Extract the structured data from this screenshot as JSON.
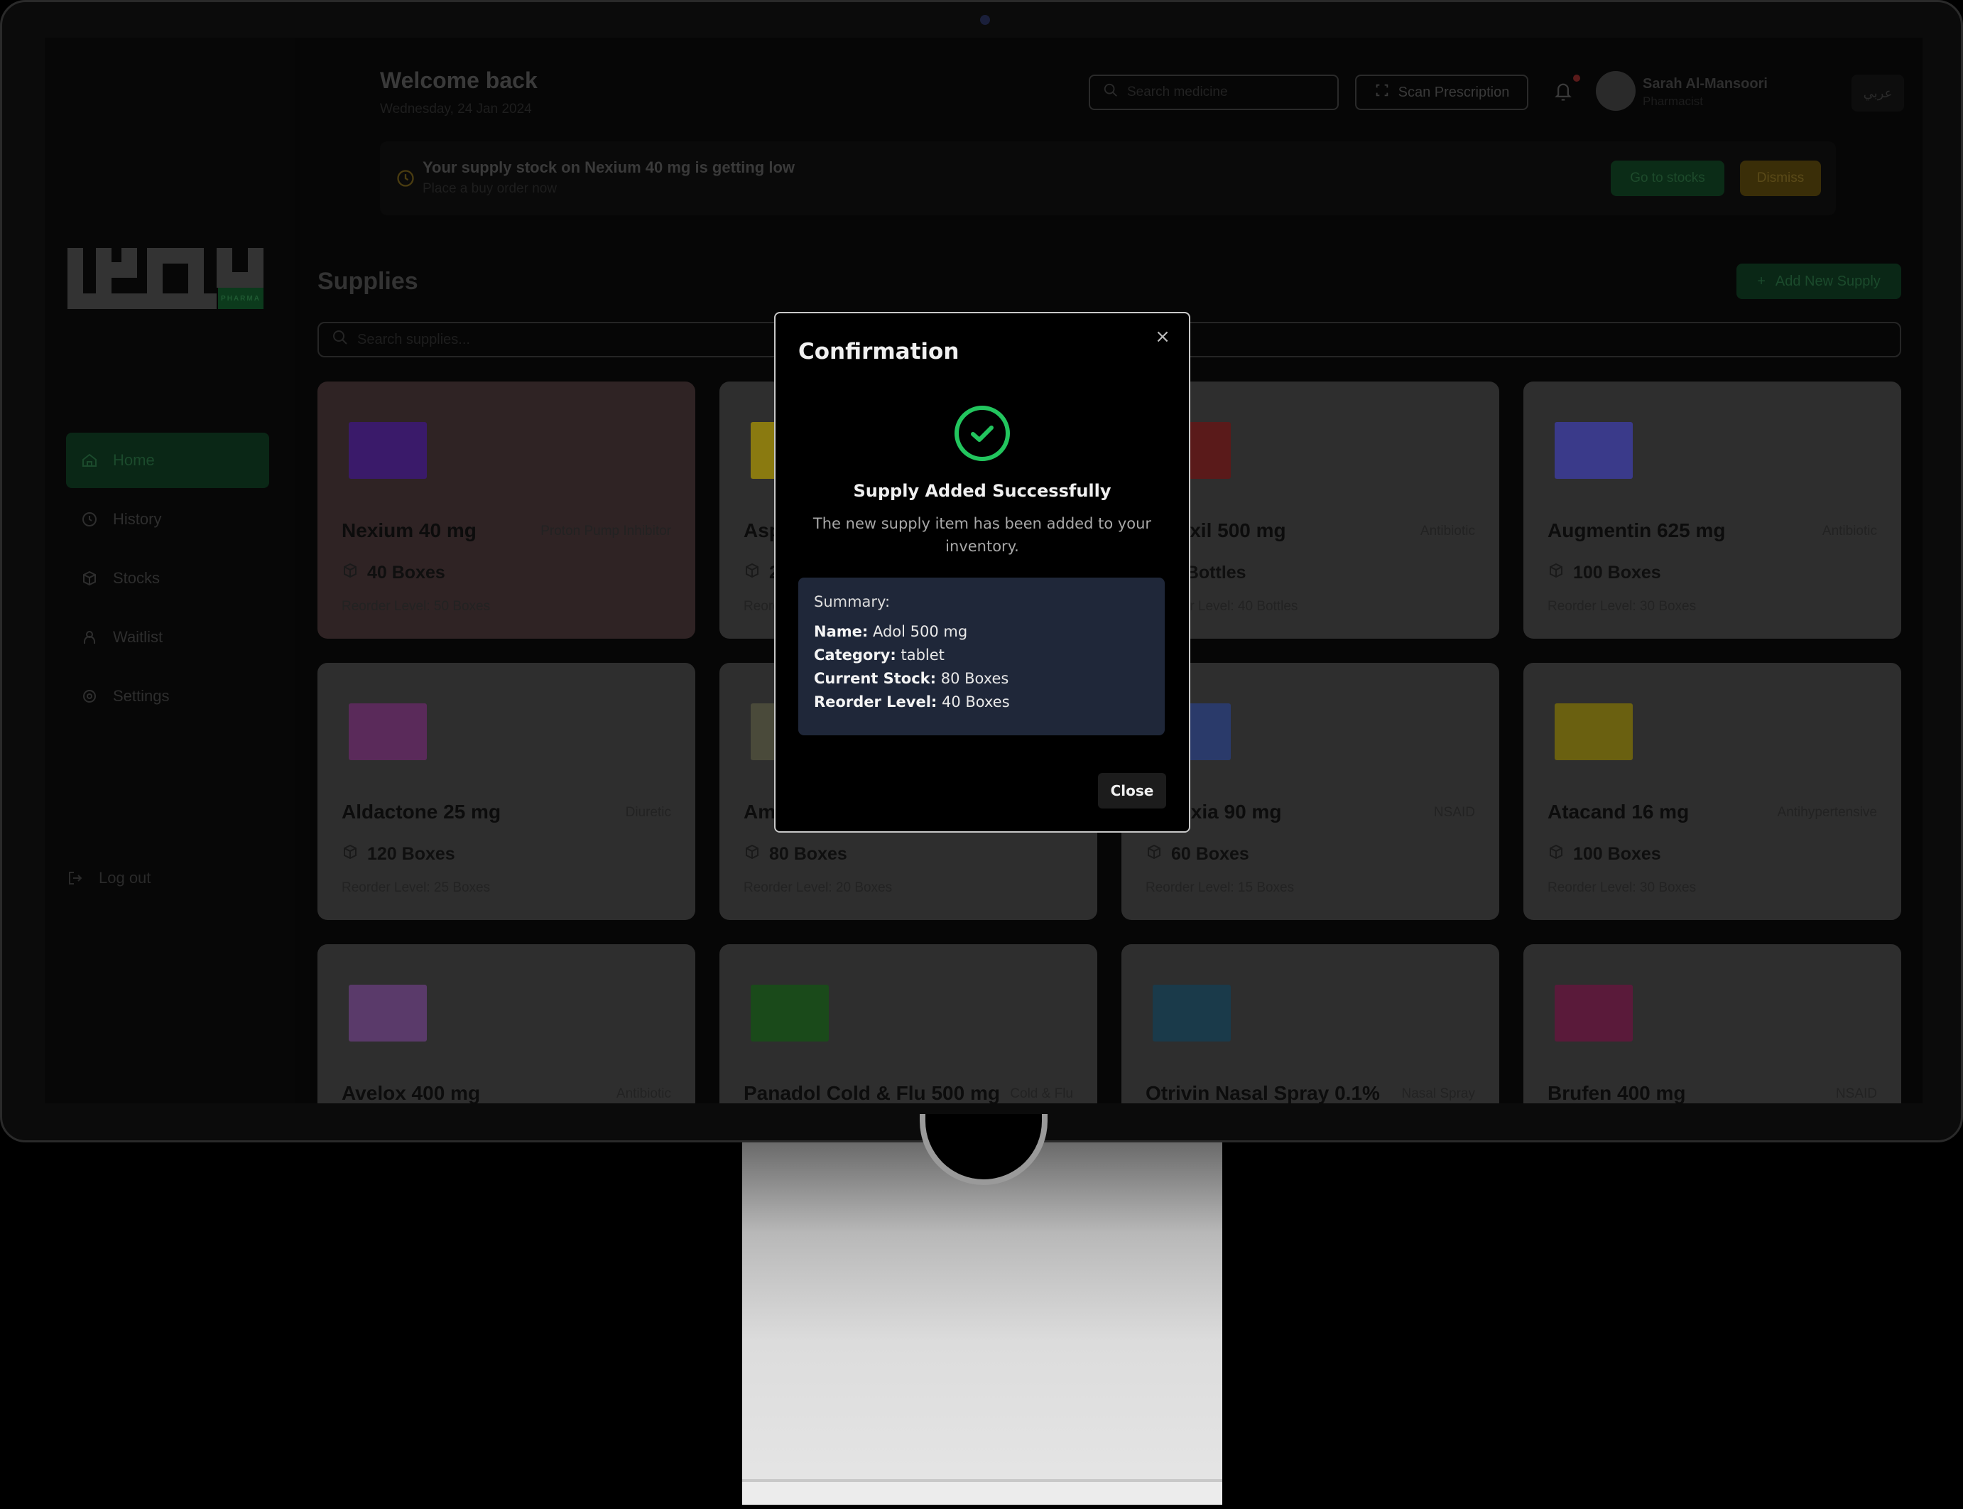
{
  "header": {
    "welcome": "Welcome back",
    "date": "Wednesday, 24 Jan 2024",
    "search_placeholder": "Search medicine",
    "scan_label": "Scan Prescription",
    "user_name": "Sarah Al-Mansoori",
    "user_role": "Pharmacist",
    "language_toggle": "عربي"
  },
  "alert": {
    "title": "Your supply stock on Nexium 40 mg is getting low",
    "subtitle": "Place a buy order now",
    "primary_action": "Go to stocks",
    "secondary_action": "Dismiss"
  },
  "sidebar": {
    "logo_tag": "PHARMA",
    "items": [
      {
        "label": "Home",
        "icon": "home-icon",
        "active": true
      },
      {
        "label": "History",
        "icon": "clock-icon",
        "active": false
      },
      {
        "label": "Stocks",
        "icon": "box-icon",
        "active": false
      },
      {
        "label": "Waitlist",
        "icon": "user-icon",
        "active": false
      },
      {
        "label": "Settings",
        "icon": "gear-icon",
        "active": false
      }
    ],
    "logout": "Log out"
  },
  "supplies": {
    "title": "Supplies",
    "add_button": "Add New Supply",
    "search_placeholder": "Search supplies...",
    "items": [
      {
        "name": "Nexium 40 mg",
        "category": "Proton Pump Inhibitor",
        "stock": "40 Boxes",
        "reorder": "Reorder Level: 50 Boxes",
        "low": true,
        "color": "#3a1a6a"
      },
      {
        "name": "Aspirin",
        "category": "",
        "stock": "2",
        "reorder": "Reorder Level",
        "low": false,
        "color": "#8a7a10"
      },
      {
        "name": "Amoxil 500 mg",
        "category": "Antibiotic",
        "stock": "0 Bottles",
        "reorder": "Reorder Level: 40 Bottles",
        "low": false,
        "color": "#5a1a1a"
      },
      {
        "name": "Augmentin 625 mg",
        "category": "Antibiotic",
        "stock": "100 Boxes",
        "reorder": "Reorder Level: 30 Boxes",
        "low": false,
        "color": "#3a3a8a"
      },
      {
        "name": "Aldactone 25 mg",
        "category": "Diuretic",
        "stock": "120 Boxes",
        "reorder": "Reorder Level: 25 Boxes",
        "low": false,
        "color": "#5a2a5a"
      },
      {
        "name": "Amaryl",
        "category": "",
        "stock": "80 Boxes",
        "reorder": "Reorder Level: 20 Boxes",
        "low": false,
        "color": "#4a4a3a"
      },
      {
        "name": "Arcoxia 90 mg",
        "category": "NSAID",
        "stock": "60 Boxes",
        "reorder": "Reorder Level: 15 Boxes",
        "low": false,
        "color": "#2a3a6a"
      },
      {
        "name": "Atacand 16 mg",
        "category": "Antihypertensive",
        "stock": "100 Boxes",
        "reorder": "Reorder Level: 30 Boxes",
        "low": false,
        "color": "#6a6010"
      },
      {
        "name": "Avelox 400 mg",
        "category": "Antibiotic",
        "stock": "",
        "reorder": "",
        "low": false,
        "color": "#5a3a6a"
      },
      {
        "name": "Panadol Cold & Flu 500 mg",
        "category": "Cold & Flu",
        "stock": "",
        "reorder": "",
        "low": false,
        "color": "#1a4a1a"
      },
      {
        "name": "Otrivin Nasal Spray 0.1%",
        "category": "Nasal Spray",
        "stock": "",
        "reorder": "",
        "low": false,
        "color": "#1a3a4a"
      },
      {
        "name": "Brufen 400 mg",
        "category": "NSAID",
        "stock": "",
        "reorder": "",
        "low": false,
        "color": "#5a1a3a"
      }
    ]
  },
  "modal": {
    "title": "Confirmation",
    "success_title": "Supply Added Successfully",
    "success_desc": "The new supply item has been added to your inventory.",
    "summary_heading": "Summary:",
    "summary": [
      {
        "label": "Name:",
        "value": "Adol 500 mg"
      },
      {
        "label": "Category:",
        "value": "tablet"
      },
      {
        "label": "Current Stock:",
        "value": "80 Boxes"
      },
      {
        "label": "Reorder Level:",
        "value": "40 Boxes"
      }
    ],
    "close_button": "Close",
    "accent": "#22c55e"
  }
}
